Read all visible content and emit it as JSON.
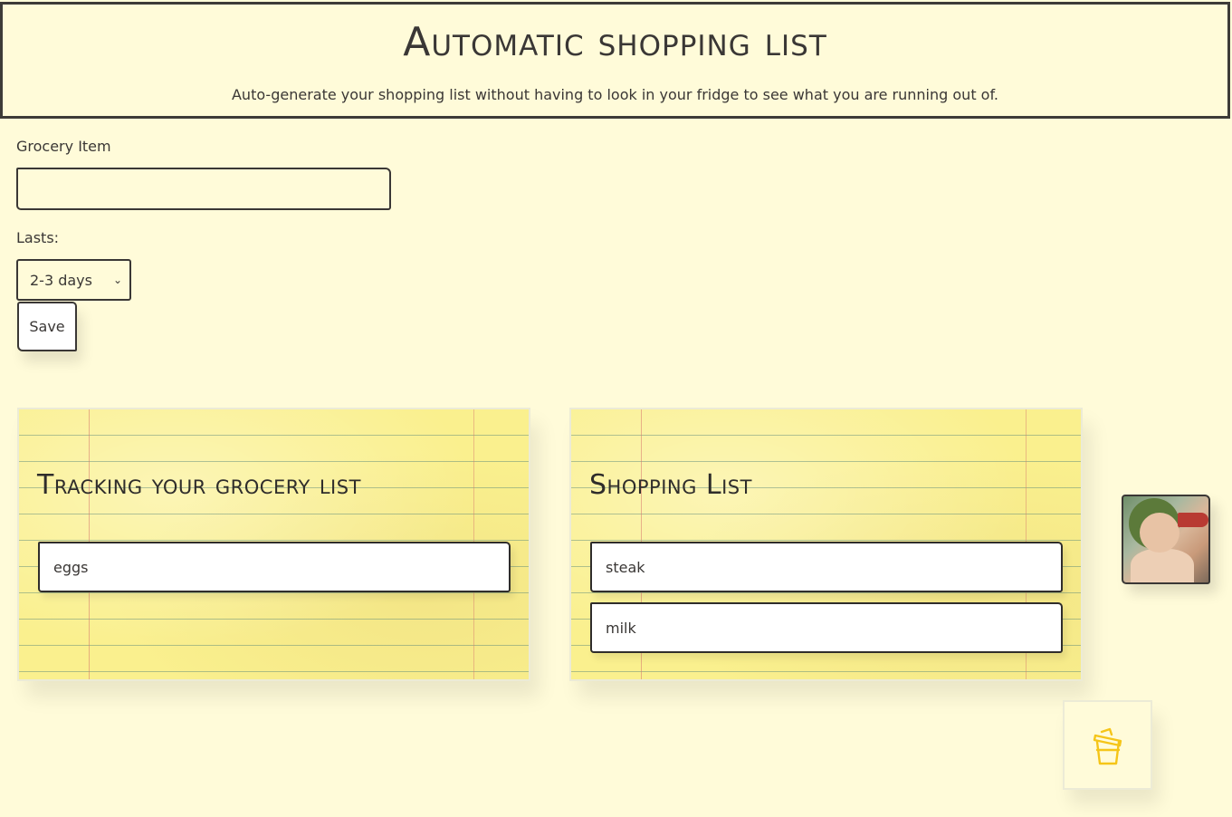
{
  "header": {
    "title": "Automatic shopping list",
    "subtitle": "Auto-generate your shopping list without having to look in your fridge to see what you are running out of."
  },
  "form": {
    "item_label": "Grocery Item",
    "item_value": "",
    "lasts_label": "Lasts:",
    "lasts_selected": "2-3 days",
    "save_label": "Save"
  },
  "tracking": {
    "title": "Tracking your grocery list",
    "items": [
      "eggs"
    ]
  },
  "shopping": {
    "title": "Shopping List",
    "items": [
      "steak",
      "milk"
    ]
  },
  "icons": {
    "avatar": "cherub-drinking-image",
    "trash": "trash-icon"
  },
  "colors": {
    "background": "#fffbd9",
    "text": "#3a3735",
    "note_paper": "#faf08e",
    "trash_accent": "#f5c518"
  }
}
